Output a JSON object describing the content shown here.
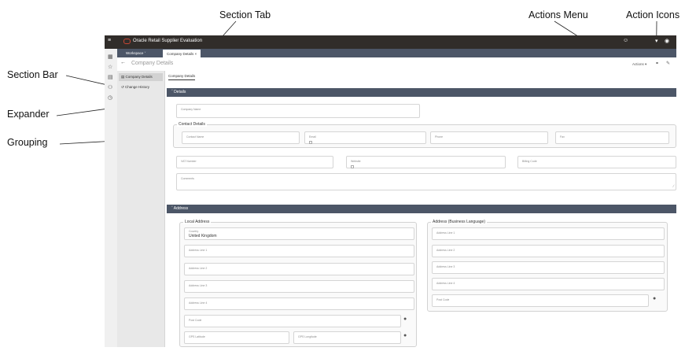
{
  "callouts": {
    "section_tab": "Section Tab",
    "actions_menu": "Actions Menu",
    "action_icons": "Action Icons",
    "section_bar": "Section Bar",
    "expander": "Expander",
    "grouping": "Grouping"
  },
  "app": {
    "title": "Oracle Retail Supplier Evaluation",
    "tabs": [
      {
        "label": "Workspace"
      },
      {
        "label": "Company Details"
      }
    ],
    "page_title": "Company Details",
    "actions_label": "Actions",
    "section_bar": {
      "items": [
        {
          "label": "Company Details"
        },
        {
          "label": "Change History"
        }
      ]
    },
    "section_tab_label": "Company Details",
    "details": {
      "header": "Details",
      "company_name_label": "Company Name",
      "contact_group": {
        "title": "Contact Details",
        "contact_name_label": "Contact Name",
        "email_label": "Email",
        "phone_label": "Phone",
        "fax_label": "Fax"
      },
      "vat_label": "VAT Number",
      "website_label": "Website",
      "billing_code_label": "Billing Code",
      "comments_label": "Comments"
    },
    "address": {
      "header": "Address",
      "local": {
        "title": "Local Address",
        "country_label": "Country",
        "country_value": "United Kingdom",
        "line1_label": "Address Line 1",
        "line2_label": "Address Line 2",
        "line3_label": "Address Line 3",
        "line4_label": "Address Line 4",
        "post_code_label": "Post Code",
        "gps_lat_label": "GPS Latitude",
        "gps_long_label": "GPS Longitude"
      },
      "business": {
        "title": "Address (Business Language)",
        "line1_label": "Address Line 1",
        "line2_label": "Address Line 2",
        "line3_label": "Address Line 3",
        "line4_label": "Address Line 4",
        "post_code_label": "Post Code"
      }
    }
  },
  "colors": {
    "topbar": "#312d2a",
    "tabbar": "#4c5667",
    "brand_red": "#c74634"
  }
}
